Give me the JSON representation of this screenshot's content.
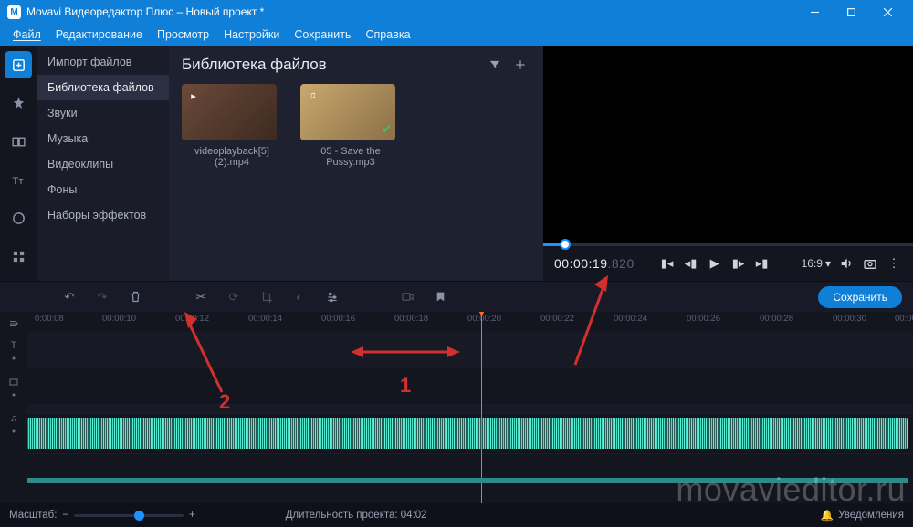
{
  "titlebar": {
    "title": "Movavi Видеоредактор Плюс – Новый проект *"
  },
  "menu": {
    "file": "Файл",
    "edit": "Редактирование",
    "view": "Просмотр",
    "settings": "Настройки",
    "save": "Сохранить",
    "help": "Справка"
  },
  "sidebar": {
    "items": [
      {
        "label": "Импорт файлов"
      },
      {
        "label": "Библиотека файлов"
      },
      {
        "label": "Звуки"
      },
      {
        "label": "Музыка"
      },
      {
        "label": "Видеоклипы"
      },
      {
        "label": "Фоны"
      },
      {
        "label": "Наборы эффектов"
      }
    ]
  },
  "library": {
    "title": "Библиотека файлов",
    "files": [
      {
        "name": "videoplayback[5] (2).mp4",
        "type": "video"
      },
      {
        "name": "05 - Save the Pussy.mp3",
        "type": "audio"
      }
    ]
  },
  "preview": {
    "time_main": "00:00:19",
    "time_ms": ".820",
    "ratio": "16:9"
  },
  "toolbar": {
    "save": "Сохранить"
  },
  "ruler": {
    "ticks": [
      "0:00:08",
      "00:00:10",
      "00:00:12",
      "00:00:14",
      "00:00:16",
      "00:00:18",
      "00:00:20",
      "00:00:22",
      "00:00:24",
      "00:00:26",
      "00:00:28",
      "00:00:30",
      "00:00"
    ]
  },
  "status": {
    "zoom_label": "Масштаб:",
    "duration": "Длительность проекта: 04:02",
    "notifications": "Уведомления"
  },
  "annotations": {
    "label1": "1",
    "label2": "2"
  },
  "watermark": "movavieditor.ru"
}
